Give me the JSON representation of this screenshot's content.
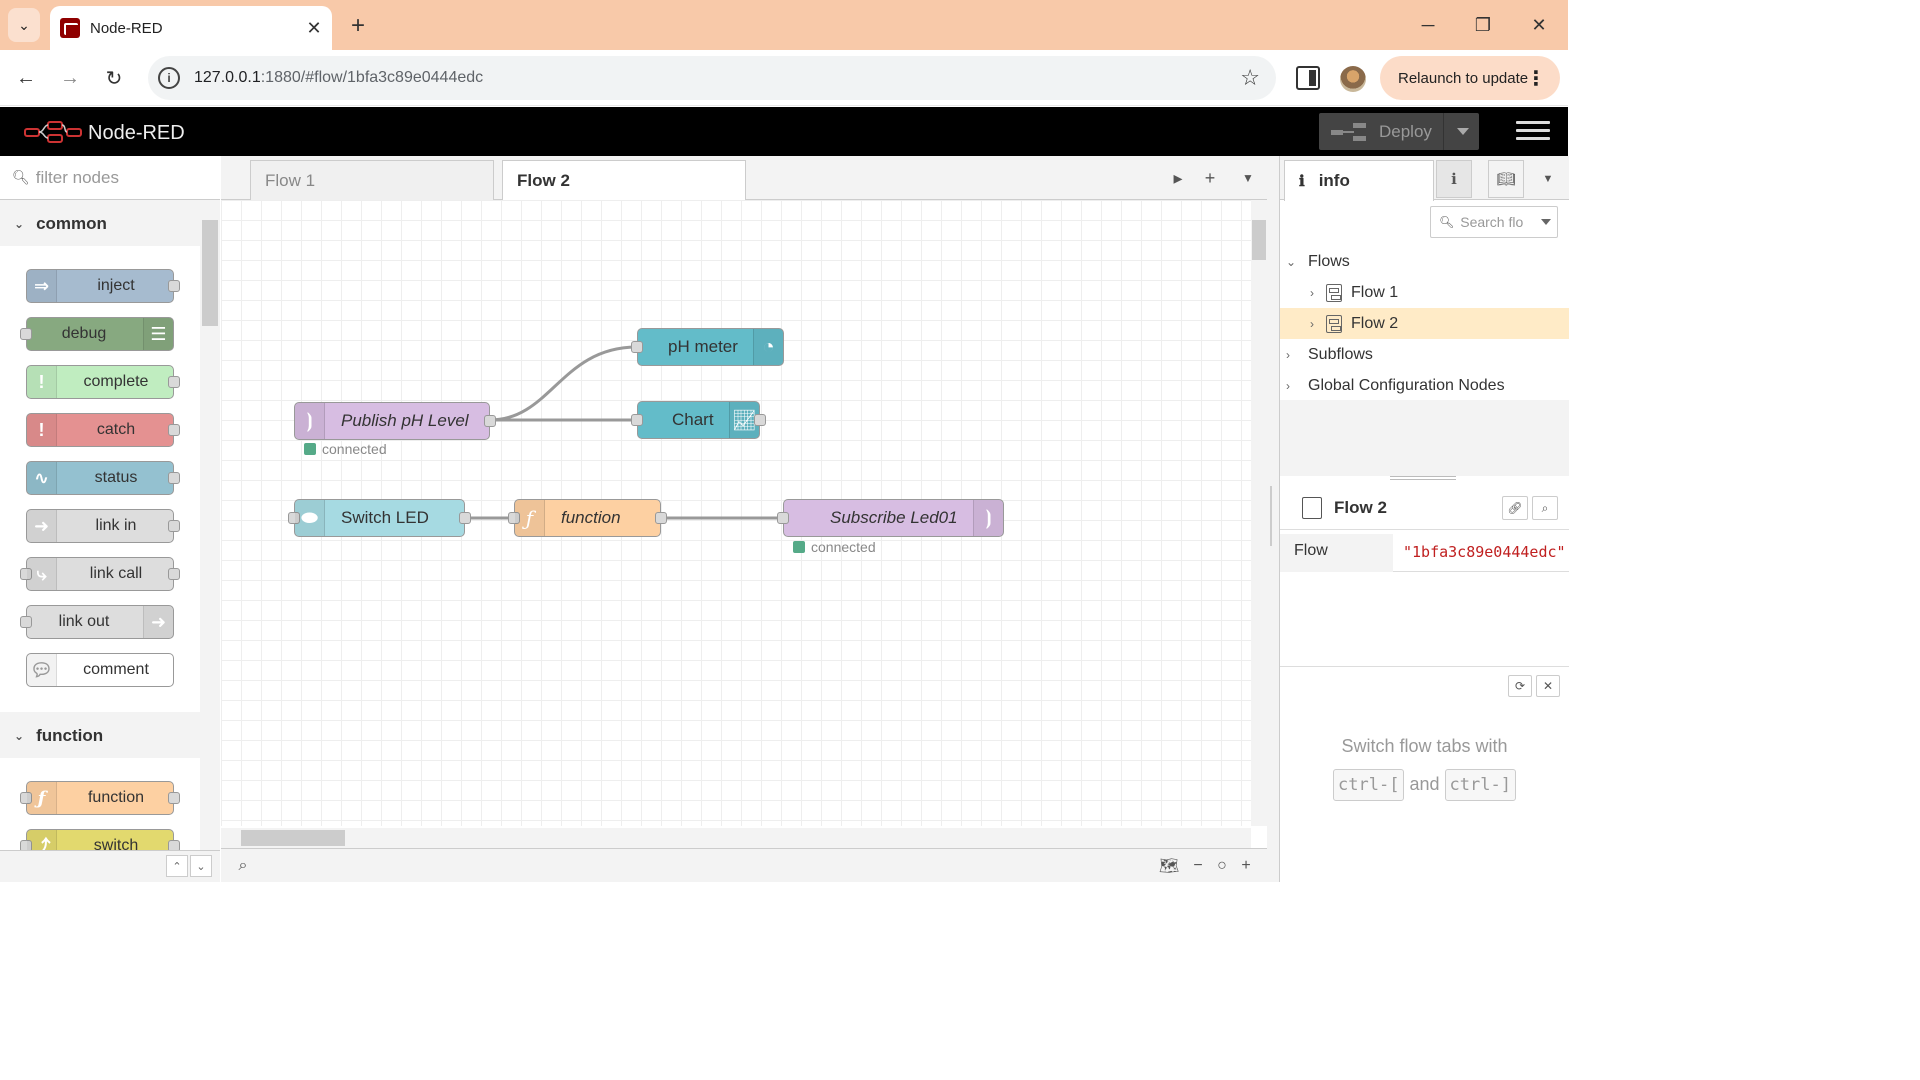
{
  "browser": {
    "tab_title": "Node-RED",
    "url_host": "127.0.0.1",
    "url_rest": ":1880/#flow/1bfa3c89e0444edc",
    "relaunch_label": "Relaunch to update",
    "colors": {
      "tabbar": "#f8c9a9",
      "relaunch": "#fcdcc8"
    }
  },
  "header": {
    "title": "Node-RED",
    "deploy_label": "Deploy"
  },
  "palette": {
    "search_placeholder": "filter nodes",
    "categories": [
      {
        "name": "common",
        "nodes": [
          "inject",
          "debug",
          "complete",
          "catch",
          "status",
          "link in",
          "link call",
          "link out",
          "comment"
        ]
      },
      {
        "name": "function",
        "nodes": [
          "function",
          "switch"
        ]
      }
    ]
  },
  "workspace": {
    "tabs": [
      "Flow 1",
      "Flow 2"
    ],
    "active_tab": "Flow 2",
    "nodes": {
      "publish": {
        "label": "Publish pH Level",
        "status": "connected",
        "color": "#d7bde2"
      },
      "phmeter": {
        "label": "pH meter",
        "color": "#63bcc9"
      },
      "chart": {
        "label": "Chart",
        "color": "#63bcc9"
      },
      "switchled": {
        "label": "Switch LED",
        "color": "#a6dae2"
      },
      "function": {
        "label": "function",
        "color": "#fdd0a2"
      },
      "subscribe": {
        "label": "Subscribe Led01",
        "status": "connected",
        "color": "#d7bde2"
      }
    }
  },
  "sidebar": {
    "tab_label": "info",
    "search_placeholder": "Search flo",
    "tree": {
      "flows": "Flows",
      "flow1": "Flow 1",
      "flow2": "Flow 2",
      "subflows": "Subflows",
      "global": "Global Configuration Nodes"
    },
    "props": {
      "title": "Flow 2",
      "key": "Flow",
      "value": "\"1bfa3c89e0444edc\""
    },
    "tip": {
      "line1": "Switch flow tabs with",
      "key1": "ctrl-[",
      "and": "and",
      "key2": "ctrl-]"
    }
  }
}
